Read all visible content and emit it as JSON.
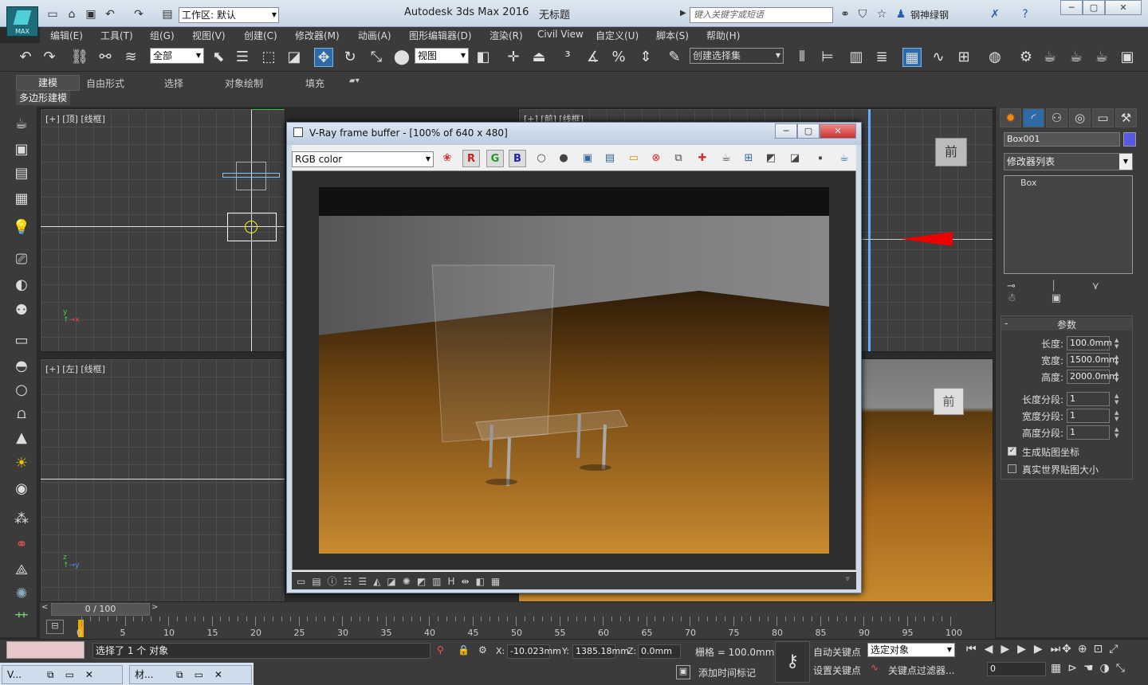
{
  "title_bar": {
    "app_title": "Autodesk 3ds Max 2016",
    "doc_title": "无标题",
    "workspace": "工作区: 默认",
    "search_placeholder": "键入关键字或短语",
    "user": "钢神绿钢",
    "logo_text": "MAX"
  },
  "menu": [
    "编辑(E)",
    "工具(T)",
    "组(G)",
    "视图(V)",
    "创建(C)",
    "修改器(M)",
    "动画(A)",
    "图形编辑器(D)",
    "渲染(R)",
    "Civil View",
    "自定义(U)",
    "脚本(S)",
    "帮助(H)"
  ],
  "toolbar": {
    "filter": "全部",
    "ref_coord": "视图",
    "selection_set": "创建选择集"
  },
  "ribbon": {
    "tabs": [
      "建模",
      "自由形式",
      "选择",
      "对象绘制",
      "填充"
    ],
    "sub_label": "多边形建模"
  },
  "viewports": {
    "top": "[+] [顶] [线框]",
    "front": "[+] [前] [线框]",
    "left": "[+] [左] [线框]",
    "view_cube_label": "前"
  },
  "vfb": {
    "title": "V-Ray frame buffer - [100% of 640 x 480]",
    "channel": "RGB color",
    "r": "R",
    "g": "G",
    "b": "B"
  },
  "command_panel": {
    "object_name": "Box001",
    "object_color": "#5a5ae0",
    "modifier_list": "修改器列表",
    "stack_item": "Box",
    "rollout_title": "参数",
    "params": [
      {
        "label": "长度:",
        "value": "100.0mm"
      },
      {
        "label": "宽度:",
        "value": "1500.0mm"
      },
      {
        "label": "高度:",
        "value": "2000.0mm"
      },
      {
        "label": "长度分段:",
        "value": "1"
      },
      {
        "label": "宽度分段:",
        "value": "1"
      },
      {
        "label": "高度分段:",
        "value": "1"
      }
    ],
    "checkbox1": "生成贴图坐标",
    "checkbox2": "真实世界贴图大小"
  },
  "timeline": {
    "frame": "0 / 100",
    "ticks": [
      "0",
      "5",
      "10",
      "15",
      "20",
      "25",
      "30",
      "35",
      "40",
      "45",
      "50",
      "55",
      "60",
      "65",
      "70",
      "75",
      "80",
      "85",
      "90",
      "95",
      "100"
    ]
  },
  "status": {
    "selected": "选择了 1 个 对象",
    "x_label": "X:",
    "x": "-10.023mm",
    "y_label": "Y:",
    "y": "1385.18mm",
    "z_label": "Z:",
    "z": "0.0mm",
    "grid": "栅格 = 100.0mm",
    "auto_key": "自动关键点",
    "set_key": "设置关键点",
    "key_mode": "选定对象",
    "key_filter": "关键点过滤器...",
    "add_time_tag": "添加时间标记",
    "frame_field": "0"
  },
  "taskbar": {
    "item1": "V...",
    "item2": "材..."
  }
}
